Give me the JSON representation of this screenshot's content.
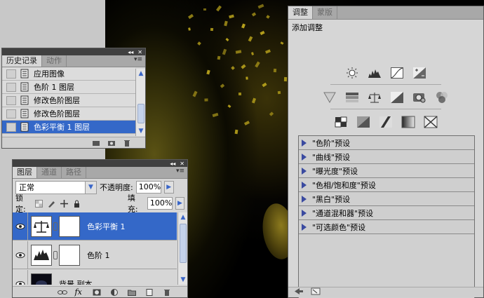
{
  "history": {
    "tabs": [
      "历史记录",
      "动作"
    ],
    "items": [
      {
        "label": "应用图像",
        "selected": false
      },
      {
        "label": "色阶 1 图层",
        "selected": false
      },
      {
        "label": "修改色阶图层",
        "selected": false
      },
      {
        "label": "修改色阶图层",
        "selected": false
      },
      {
        "label": "色彩平衡 1 图层",
        "selected": true
      }
    ]
  },
  "layers": {
    "tabs": [
      "图层",
      "通道",
      "路径"
    ],
    "blend_mode": "正常",
    "opacity_label": "不透明度:",
    "opacity_value": "100%",
    "lock_label": "锁定:",
    "fill_label": "填充:",
    "fill_value": "100%",
    "rows": [
      {
        "name": "色彩平衡 1",
        "selected": true,
        "type": "color-balance"
      },
      {
        "name": "色阶 1",
        "selected": false,
        "type": "levels"
      },
      {
        "name": "背景 副本",
        "selected": false,
        "type": "image"
      }
    ],
    "footer_icons": [
      "link-icon",
      "fx-icon",
      "mask-icon",
      "adjustment-icon",
      "folder-icon",
      "new-layer-icon",
      "trash-icon"
    ]
  },
  "adjustments": {
    "tabs": [
      "调整",
      "蒙版"
    ],
    "title": "添加调整",
    "row1_icons": [
      "brightness-icon",
      "levels-icon",
      "curves-icon",
      "exposure-icon"
    ],
    "row2_icons": [
      "vibrance-icon",
      "hue-saturation-icon",
      "color-balance-icon",
      "black-white-icon",
      "photo-filter-icon",
      "channel-mixer-icon"
    ],
    "row3_icons": [
      "invert-icon",
      "posterize-icon",
      "threshold-icon",
      "gradient-map-icon",
      "selective-color-icon"
    ],
    "presets": [
      "\"色阶\"预设",
      "\"曲线\"预设",
      "\"曝光度\"预设",
      "\"色相/饱和度\"预设",
      "\"黑白\"预设",
      "\"通道混和器\"预设",
      "\"可选颜色\"预设"
    ]
  },
  "colors": {
    "selection": "#3468c8",
    "panel": "#d6d6d6",
    "accent_gold": "#b8a21c"
  }
}
